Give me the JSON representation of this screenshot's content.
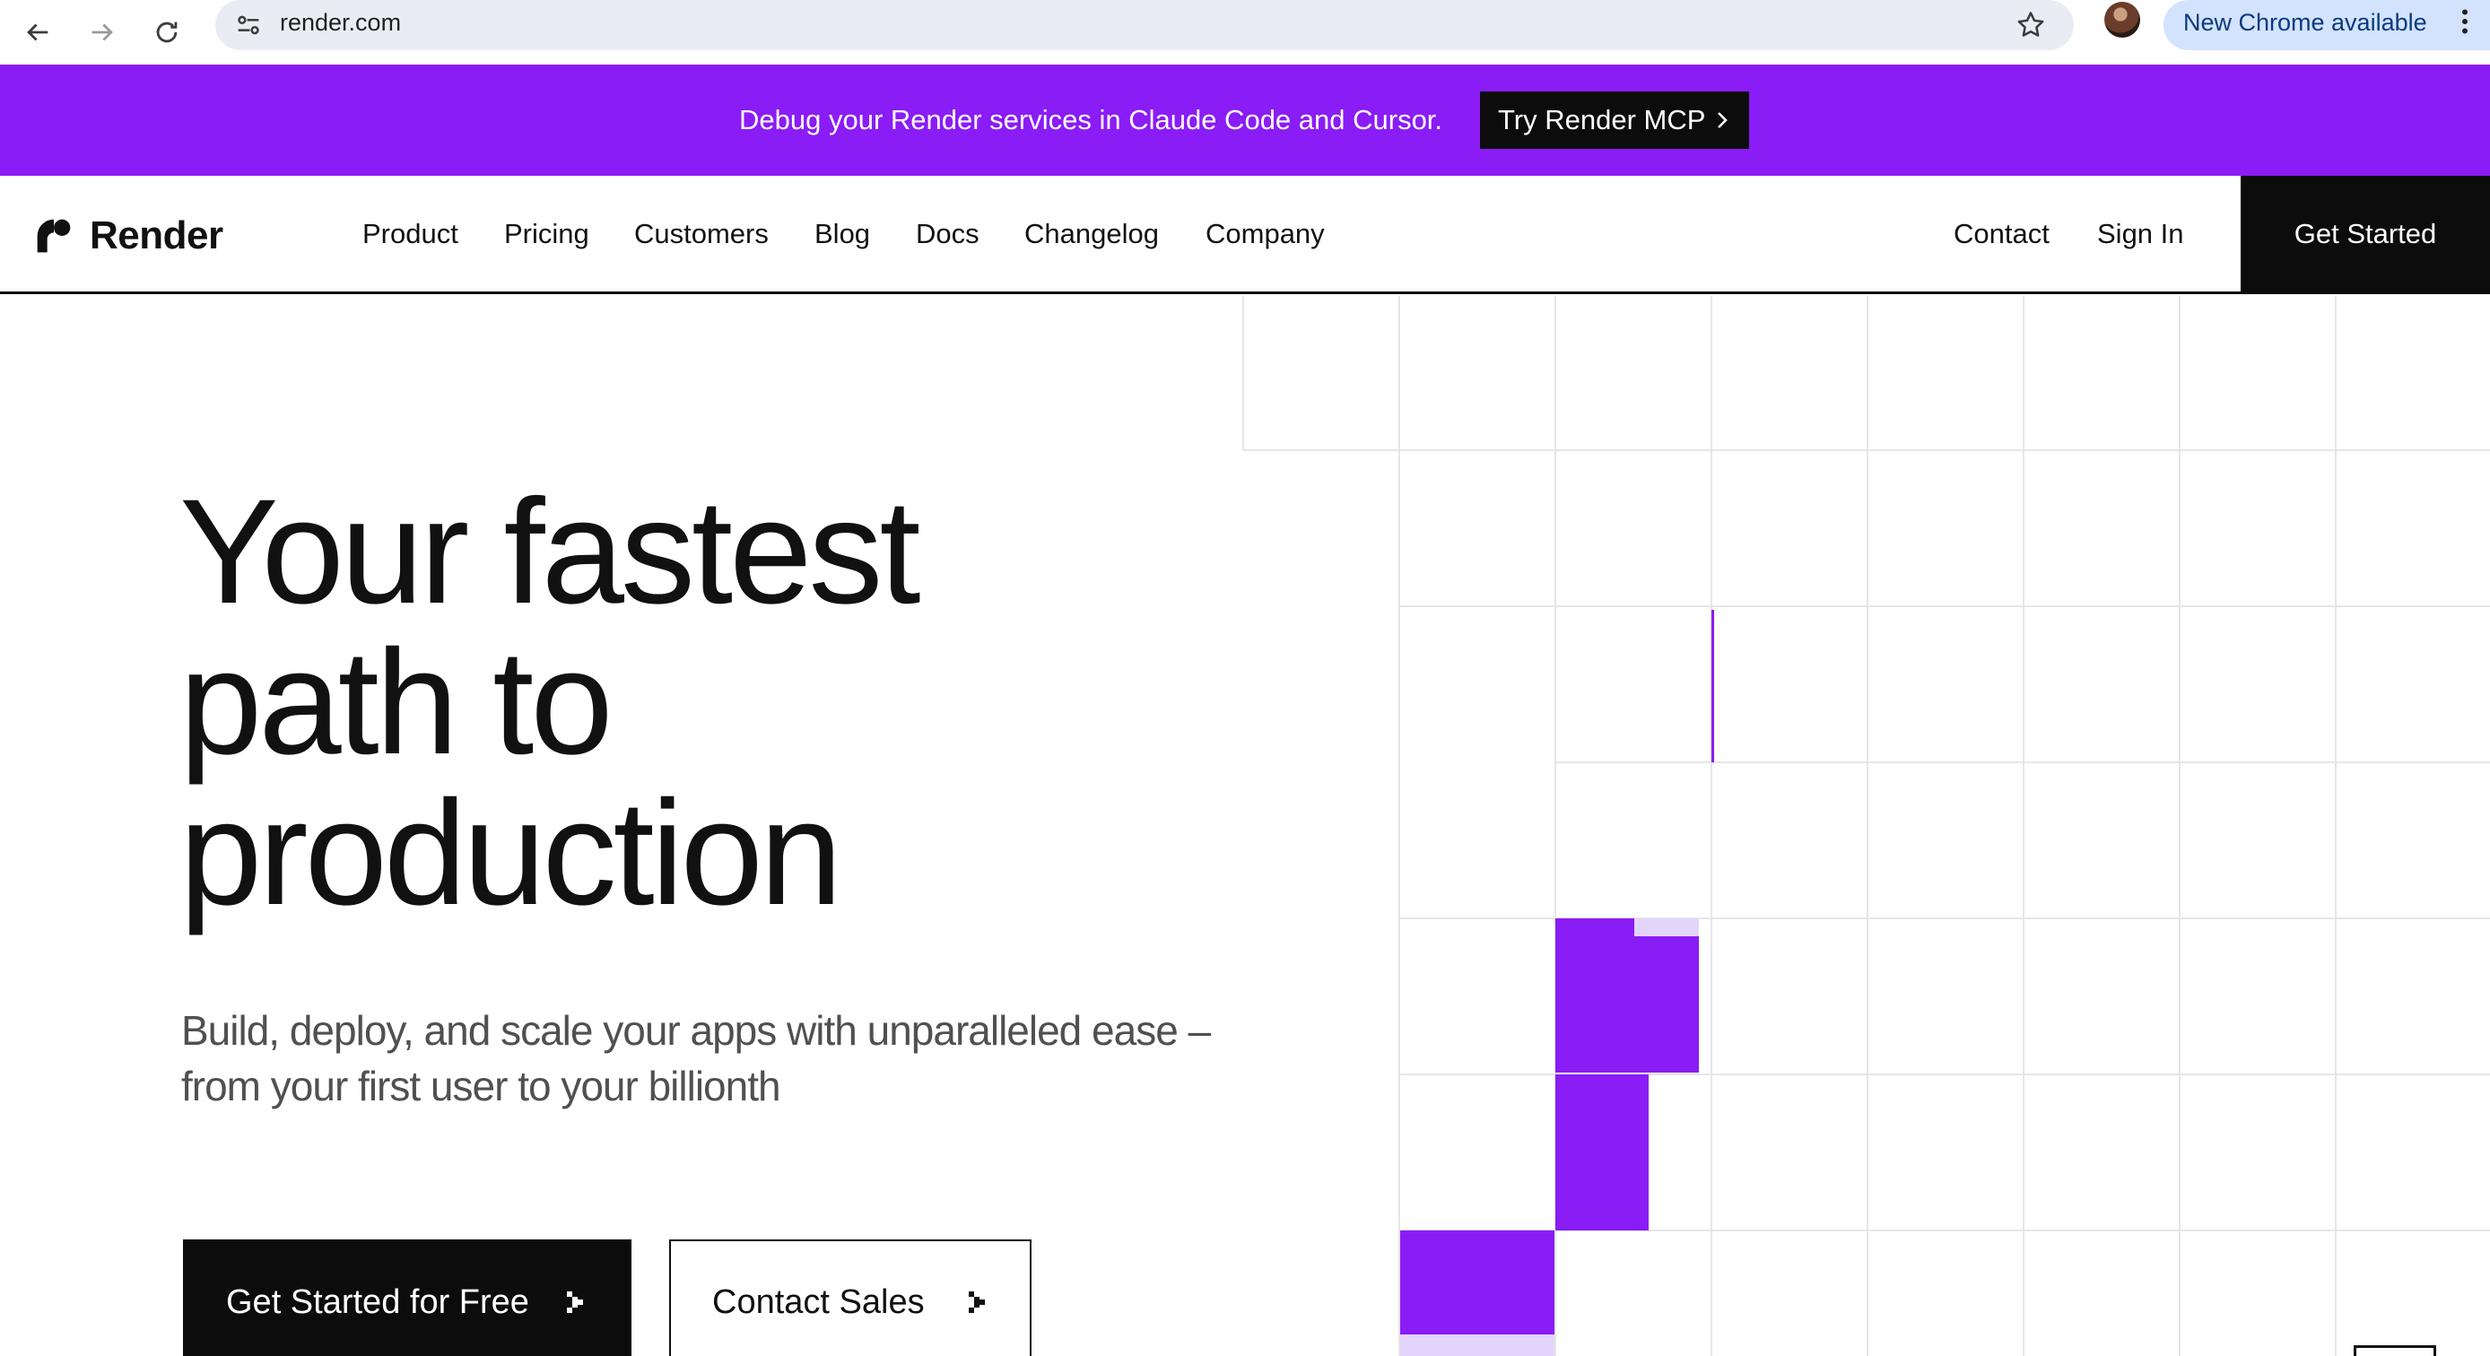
{
  "browser": {
    "url": "render.com",
    "update_label": "New Chrome available",
    "icons": {
      "back": "arrow-left",
      "forward": "arrow-right",
      "reload": "reload",
      "site_info": "tune",
      "bookmark": "star",
      "menu": "kebab"
    }
  },
  "banner": {
    "message": "Debug your Render services in Claude Code and Cursor.",
    "cta_label": "Try Render MCP",
    "background": "#8a1cf5"
  },
  "header": {
    "logo_text": "Render",
    "nav": [
      {
        "label": "Product"
      },
      {
        "label": "Pricing"
      },
      {
        "label": "Customers"
      },
      {
        "label": "Blog"
      },
      {
        "label": "Docs"
      },
      {
        "label": "Changelog"
      },
      {
        "label": "Company"
      }
    ],
    "contact_label": "Contact",
    "signin_label": "Sign In",
    "get_started_label": "Get Started"
  },
  "hero": {
    "title_lines": [
      "Your fastest",
      "path to",
      "production"
    ],
    "subtitle_lines": [
      "Build, deploy, and scale your apps with unparalleled ease –",
      "from your first user to your billionth"
    ],
    "primary_cta": "Get Started for Free",
    "secondary_cta": "Contact Sales"
  },
  "colors": {
    "accent": "#8a1cf5",
    "accent_light": "#e3d4fb",
    "ink": "#0c0c0c",
    "grid_line": "#e6e6e6"
  }
}
